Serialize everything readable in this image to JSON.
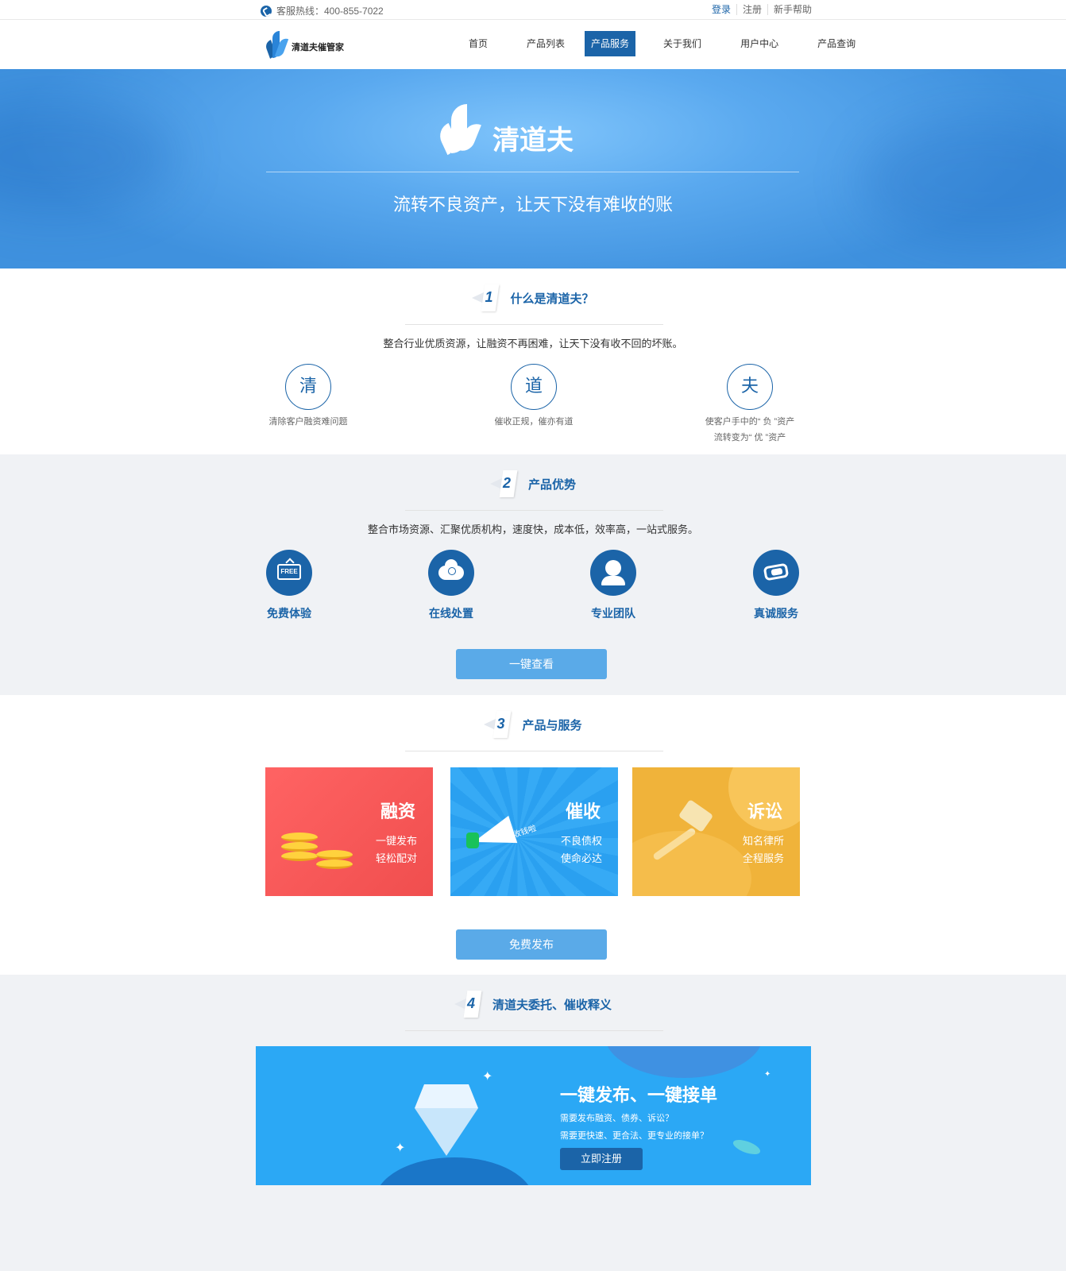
{
  "topbar": {
    "hotline": "客服热线：400-855-7022",
    "links": [
      "登录",
      "注册",
      "新手帮助"
    ]
  },
  "header": {
    "logo_text": "清道夫催管家",
    "nav": [
      "首页",
      "产品列表",
      "产品服务",
      "关于我们",
      "用户中心",
      "产品查询"
    ],
    "active_nav": "产品服务"
  },
  "banner": {
    "title": "清道夫",
    "subtitle": "流转不良资产，让天下没有难收的账"
  },
  "section1": {
    "num": "1",
    "title": "什么是清道夫？",
    "desc": "整合行业优质资源，让融资不再困难，让天下没有收不回的坏账。",
    "items": [
      {
        "char": "清",
        "desc": "清除客户融资难问题"
      },
      {
        "char": "道",
        "desc": "催收正规，催亦有道"
      },
      {
        "char": "夫",
        "desc": "使客户手中的“ 负 ”资产",
        "desc2": "流转变为“ 优 ”资产"
      }
    ]
  },
  "section2": {
    "num": "2",
    "title": "产品优势",
    "desc": "整合市场资源、汇聚优质机构，速度快，成本低，效率高，一站式服务。",
    "features": [
      {
        "label": "免费体验",
        "icon": "free-icon",
        "icon_text": "FREE"
      },
      {
        "label": "在线处置",
        "icon": "cloud-icon"
      },
      {
        "label": "专业团队",
        "icon": "team-icon"
      },
      {
        "label": "真诚服务",
        "icon": "handshake-icon"
      }
    ],
    "button": "一键查看"
  },
  "section3": {
    "num": "3",
    "title": "产品与服务",
    "cards": [
      {
        "title": "融资",
        "line1": "一键发布",
        "line2": "轻松配对",
        "color": "#f04e4e"
      },
      {
        "title": "催收",
        "line1": "不良债权",
        "line2": "使命必达",
        "sticker": "收钱啦",
        "color": "#2aa0f0"
      },
      {
        "title": "诉讼",
        "line1": "知名律所",
        "line2": "全程服务",
        "color": "#f0b33a"
      }
    ],
    "button": "免费发布"
  },
  "section4": {
    "num": "4",
    "title": "清道夫委托、催收释义",
    "promo": {
      "title": "一键发布、一键接单",
      "line1": "需要发布融资、债券、诉讼？",
      "line2": "需要更快速、更合法、更专业的接单？",
      "button": "立即注册"
    }
  },
  "colors": {
    "primary": "#1b64a8",
    "button": "#5aaae8",
    "section_bg": "#f0f2f5"
  }
}
